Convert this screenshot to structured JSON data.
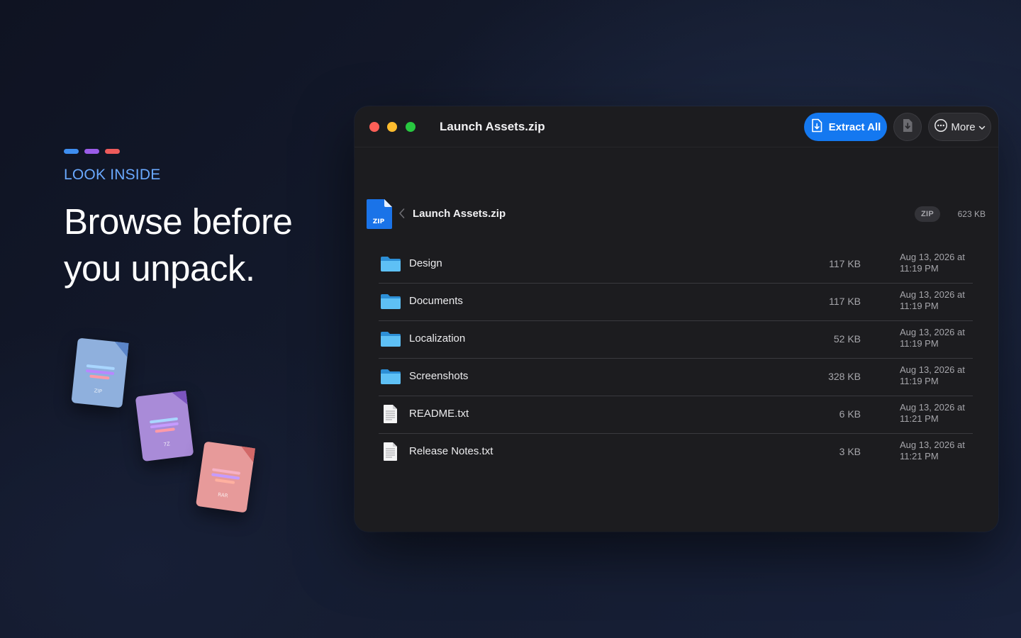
{
  "hero": {
    "accent_colors": [
      "#3e8ef0",
      "#9a5ce8",
      "#ee5b5b"
    ],
    "eyebrow": "LOOK INSIDE",
    "headline_line1": "Browse before",
    "headline_line2": "you unpack."
  },
  "archive_icons": [
    {
      "label": "ZIP",
      "color": "#8fb0dd"
    },
    {
      "label": "7Z",
      "color": "#a98bd8"
    },
    {
      "label": "RAR",
      "color": "#e79a9a"
    }
  ],
  "window": {
    "title": "Launch Assets.zip",
    "extract_label": "Extract All",
    "more_label": "More",
    "accent": "#1478f0"
  },
  "archive": {
    "icon_label": "ZIP",
    "name": "Launch Assets.zip",
    "type_badge": "ZIP",
    "total_size": "623 KB"
  },
  "files": [
    {
      "name": "Design",
      "kind": "folder",
      "size": "117 KB",
      "date_line1": "Aug 13, 2026 at",
      "date_line2": "11:19 PM"
    },
    {
      "name": "Documents",
      "kind": "folder",
      "size": "117 KB",
      "date_line1": "Aug 13, 2026 at",
      "date_line2": "11:19 PM"
    },
    {
      "name": "Localization",
      "kind": "folder",
      "size": "52 KB",
      "date_line1": "Aug 13, 2026 at",
      "date_line2": "11:19 PM"
    },
    {
      "name": "Screenshots",
      "kind": "folder",
      "size": "328 KB",
      "date_line1": "Aug 13, 2026 at",
      "date_line2": "11:19 PM"
    },
    {
      "name": "README.txt",
      "kind": "text-file",
      "size": "6 KB",
      "date_line1": "Aug 13, 2026 at",
      "date_line2": "11:21 PM"
    },
    {
      "name": "Release Notes.txt",
      "kind": "text-file",
      "size": "3 KB",
      "date_line1": "Aug 13, 2026 at",
      "date_line2": "11:21 PM"
    }
  ]
}
